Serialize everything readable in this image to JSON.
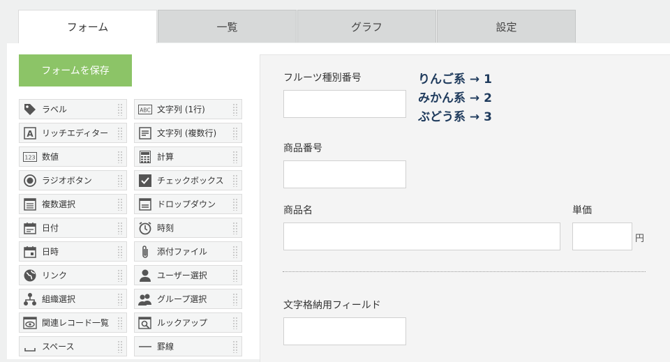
{
  "tabs": [
    {
      "label": "フォーム",
      "active": true
    },
    {
      "label": "一覧",
      "active": false
    },
    {
      "label": "グラフ",
      "active": false
    },
    {
      "label": "設定",
      "active": false
    }
  ],
  "save_button": "フォームを保存",
  "palette": {
    "left": [
      {
        "label": "ラベル",
        "icon": "label-icon"
      },
      {
        "label": "リッチエディター",
        "icon": "rich-editor-icon"
      },
      {
        "label": "数値",
        "icon": "number-icon"
      },
      {
        "label": "ラジオボタン",
        "icon": "radio-icon"
      },
      {
        "label": "複数選択",
        "icon": "multi-select-icon"
      },
      {
        "label": "日付",
        "icon": "date-icon"
      },
      {
        "label": "日時",
        "icon": "datetime-icon"
      },
      {
        "label": "リンク",
        "icon": "link-icon"
      },
      {
        "label": "組織選択",
        "icon": "org-select-icon"
      },
      {
        "label": "関連レコード一覧",
        "icon": "related-records-icon"
      },
      {
        "label": "スペース",
        "icon": "space-icon"
      }
    ],
    "right": [
      {
        "label": "文字列 (1行)",
        "icon": "text-line-icon"
      },
      {
        "label": "文字列 (複数行)",
        "icon": "text-multiline-icon"
      },
      {
        "label": "計算",
        "icon": "calculator-icon"
      },
      {
        "label": "チェックボックス",
        "icon": "checkbox-icon"
      },
      {
        "label": "ドロップダウン",
        "icon": "dropdown-icon"
      },
      {
        "label": "時刻",
        "icon": "clock-icon"
      },
      {
        "label": "添付ファイル",
        "icon": "attachment-icon"
      },
      {
        "label": "ユーザー選択",
        "icon": "user-icon"
      },
      {
        "label": "グループ選択",
        "icon": "group-icon"
      },
      {
        "label": "ルックアップ",
        "icon": "lookup-icon"
      },
      {
        "label": "罫線",
        "icon": "line-icon"
      }
    ],
    "icon_text": {
      "text_line": "ABC",
      "number": "123"
    }
  },
  "form": {
    "fruit_label": "フルーツ種別番号",
    "note": [
      "りんご系 → 1",
      "みかん系 → 2",
      "ぶどう系 → 3"
    ],
    "product_no_label": "商品番号",
    "product_name_label": "商品名",
    "unit_price_label": "単価",
    "unit_price_suffix": "円",
    "text_field_label": "文字格納用フィールド"
  },
  "colors": {
    "save_button": "#8cc467",
    "note_text": "#1e3a5c",
    "tab_inactive": "#d7d9d9"
  }
}
